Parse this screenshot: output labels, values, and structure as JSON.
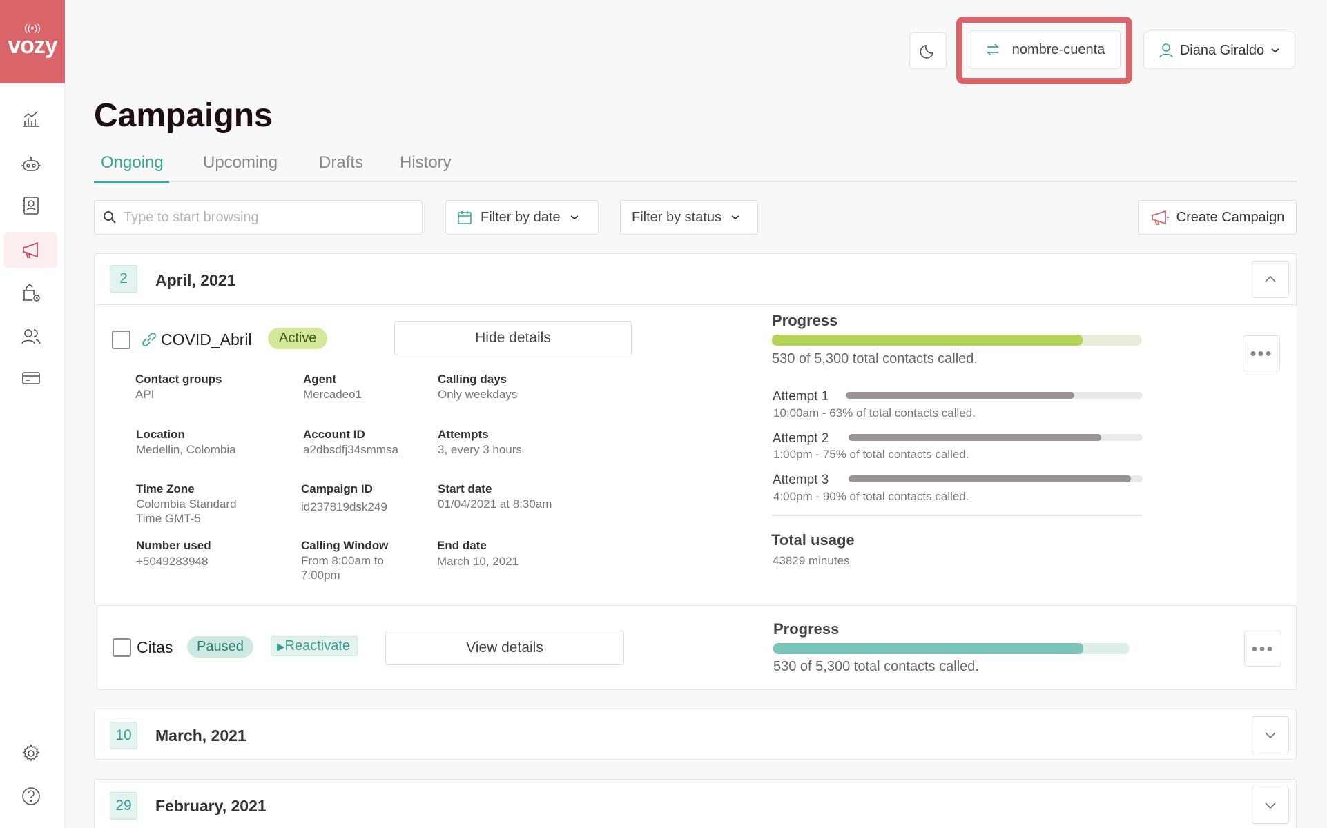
{
  "brand": {
    "logo_text": "vozy",
    "accent": "#d9646a",
    "teal": "#3aa896"
  },
  "sidebar": {
    "items": [
      {
        "name": "analytics-icon"
      },
      {
        "name": "bot-icon"
      },
      {
        "name": "contacts-icon"
      },
      {
        "name": "megaphone-icon",
        "active": true
      },
      {
        "name": "scheduled-calls-icon"
      },
      {
        "name": "users-icon"
      },
      {
        "name": "billing-icon"
      }
    ],
    "bottom": [
      {
        "name": "gear-icon"
      },
      {
        "name": "help-icon"
      }
    ]
  },
  "topbar": {
    "account_name": "nombre-cuenta",
    "user_name": "Diana Giraldo"
  },
  "page": {
    "title": "Campaigns"
  },
  "tabs": [
    {
      "label": "Ongoing",
      "active": true
    },
    {
      "label": "Upcoming"
    },
    {
      "label": "Drafts"
    },
    {
      "label": "History"
    }
  ],
  "toolbar": {
    "search_placeholder": "Type to start browsing",
    "filter_date": "Filter by date",
    "filter_status": "Filter by status",
    "create_label": "Create Campaign"
  },
  "groups": [
    {
      "count": "2",
      "title": "April, 2021",
      "expanded": true
    },
    {
      "count": "10",
      "title": "March, 2021",
      "expanded": false
    },
    {
      "count": "29",
      "title": "February, 2021",
      "expanded": false
    }
  ],
  "campaign1": {
    "name": "COVID_Abril",
    "status": "Active",
    "details_button": "Hide details",
    "info": {
      "contact_groups_label": "Contact groups",
      "contact_groups": "API",
      "agent_label": "Agent",
      "agent": "Mercadeo1",
      "calling_days_label": "Calling days",
      "calling_days": "Only weekdays",
      "location_label": "Location",
      "location": "Medellin, Colombia",
      "account_id_label": "Account ID",
      "account_id": "a2dbsdfj34smmsa",
      "attempts_label": "Attempts",
      "attempts": "3, every 3 hours",
      "time_zone_label": "Time Zone",
      "time_zone_1": "Colombia Standard",
      "time_zone_2": "Time GMT-5",
      "campaign_id_label": "Campaign ID",
      "campaign_id": "id237819dsk249",
      "start_date_label": "Start date",
      "start_date": "01/04/2021 at 8:30am",
      "number_used_label": "Number used",
      "number_used": "+5049283948",
      "calling_window_label": "Calling Window",
      "calling_window_1": "From 8:00am to",
      "calling_window_2": "7:00pm",
      "end_date_label": "End date",
      "end_date": "March 10, 2021"
    },
    "progress": {
      "title": "Progress",
      "fraction": 0.84,
      "text": "530 of 5,300 total contacts called.",
      "bar_color": "#b5d356",
      "track_color": "#e8efd9"
    },
    "attempts": [
      {
        "label": "Attempt 1",
        "fraction": 0.77,
        "desc": "10:00am - 63% of total contacts called."
      },
      {
        "label": "Attempt 2",
        "fraction": 0.86,
        "desc": "1:00pm - 75% of total contacts called."
      },
      {
        "label": "Attempt 3",
        "fraction": 0.96,
        "desc": "4:00pm - 90% of total contacts called."
      }
    ],
    "usage": {
      "title": "Total usage",
      "value": "43829 minutes"
    }
  },
  "campaign2": {
    "name": "Citas",
    "status": "Paused",
    "reactivate": "Reactivate",
    "details_button": "View details",
    "progress": {
      "title": "Progress",
      "fraction": 0.87,
      "text": "530 of 5,300 total contacts called.",
      "bar_color": "#7bc4b8",
      "track_color": "#dcefeb"
    }
  }
}
